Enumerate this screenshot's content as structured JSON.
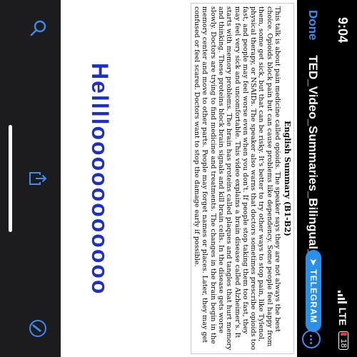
{
  "status_bar": {
    "time": "9:04",
    "network": "LTE",
    "battery_level": "18"
  },
  "nav": {
    "done_label": "Done",
    "title": "TED_Video_Summaries_Bilingual_...",
    "telegram_badge": "TELEGRAM"
  },
  "document": {
    "summary_title": "English Summary (B1-B2)",
    "summary_text": "This talk is about pain medicine called opioids. The speaker says they are not always the best choice. Opioids block pain but can cause problems like dependency. Some people feel happy from them, some get sick, but that can be risky. It's better to try other ways to stop pain, like Tylenol, physical therapy, or NSAIDs. The speaker also warns that doctors sometimes prescribe opioids too fast, and people may feel worse even when you don't. If people stop taking them too fast, they may feel very sick and uncomfortable. This video explains a brain disease called Alzheimer's. It starts with memory problems. The brain has proteins called plaques and tangles that hurt memory and thinking. These proteins block brain signals and kill brain cells. In the disease gets worse slowly. Doctors are trying to find medicine and treatments. The changes in the brain begin in the memory center and move to other parts. People may forget names or places. Later, they may get confused or feel scared. Doctors want to stop the damage early if possible.",
    "overlay_text": "Hellllooooooooooo"
  },
  "colors": {
    "accent": "#3b8df3",
    "telegram": "#2a8fe6",
    "overlay_text": "#1e2fc4",
    "battery_low": "#e53935"
  },
  "toolbar": {
    "icons": [
      "search-icon",
      "share-icon",
      "markup-icon"
    ]
  }
}
